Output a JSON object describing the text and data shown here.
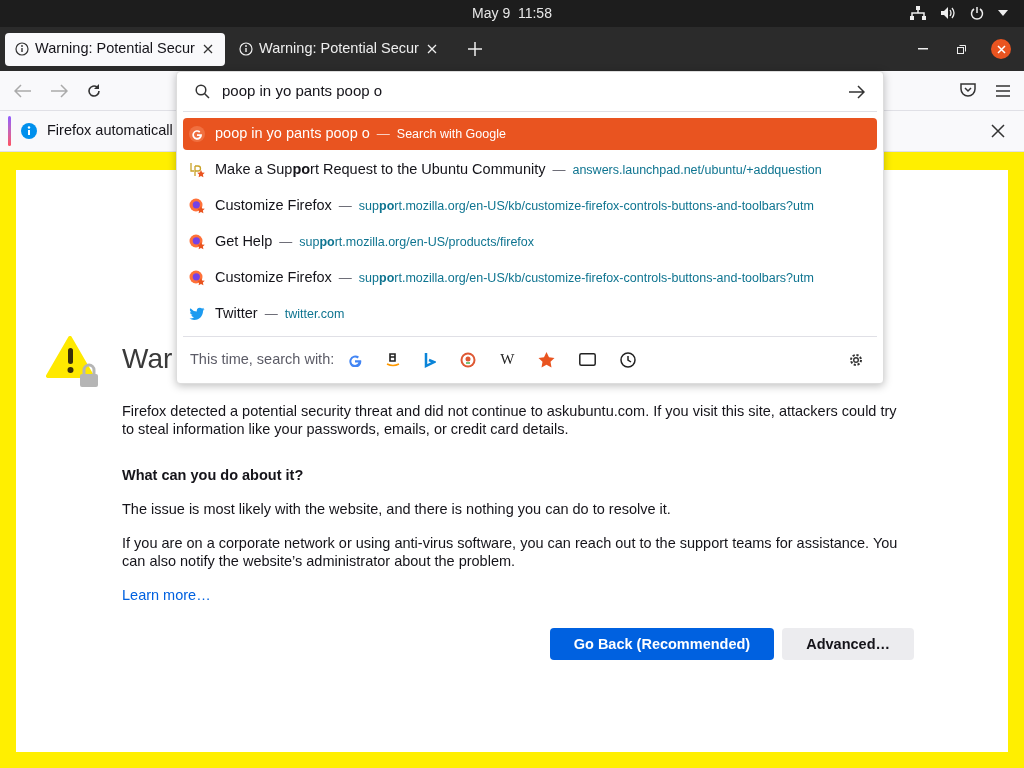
{
  "top_bar": {
    "clock": "May 9  11:58"
  },
  "tabs": [
    {
      "title": "Warning: Potential Secur",
      "selected": true
    },
    {
      "title": "Warning: Potential Secur",
      "selected": false
    }
  ],
  "url_bar": {
    "value": "poop in yo pants poop o"
  },
  "results": [
    {
      "kind": "search",
      "title": "poop in yo pants poop o",
      "separator": "—",
      "detail": "Search with Google",
      "selected": true
    },
    {
      "kind": "launchpad",
      "title": "Make a Sup**po**rt Request to the Ubuntu Community",
      "separator": "—",
      "detail": "answers.launchpad.net/ubuntu/+addquestion",
      "selected": false
    },
    {
      "kind": "firefox",
      "title": "Customize Firefox",
      "separator": "—",
      "detail": "sup**po**rt.mozilla.org/en-US/kb/customize-firefox-controls-buttons-and-toolbars?utm",
      "selected": false
    },
    {
      "kind": "firefox",
      "title": "Get Help",
      "separator": "—",
      "detail": "sup**po**rt.mozilla.org/en-US/products/firefox",
      "selected": false
    },
    {
      "kind": "firefox",
      "title": "Customize Firefox",
      "separator": "—",
      "detail": "sup**po**rt.mozilla.org/en-US/kb/customize-firefox-controls-buttons-and-toolbars?utm",
      "selected": false
    },
    {
      "kind": "twitter",
      "title": "Twitter",
      "separator": "—",
      "detail": "twitter.com",
      "selected": false
    }
  ],
  "search_with": {
    "label": "This time, search with:",
    "wiki_glyph": "W"
  },
  "notification": {
    "text": "Firefox automaticall"
  },
  "page": {
    "heading": "War",
    "intro": "Firefox detected a potential security threat and did not continue to askubuntu.com. If you visit this site, attackers could try to steal information like your passwords, emails, or credit card details.",
    "subheading": "What can you do about it?",
    "paragraphs": [
      "The issue is most likely with the website, and there is nothing you can do to resolve it.",
      "If you are on a corporate network or using anti-virus software, you can reach out to the support teams for assistance. You can also notify the website’s administrator about the problem."
    ],
    "learn_more": "Learn more…",
    "buttons": [
      {
        "kind": "primary",
        "label": "Go Back (Recommended)"
      },
      {
        "kind": "secondary",
        "label": "Advanced…"
      }
    ]
  }
}
